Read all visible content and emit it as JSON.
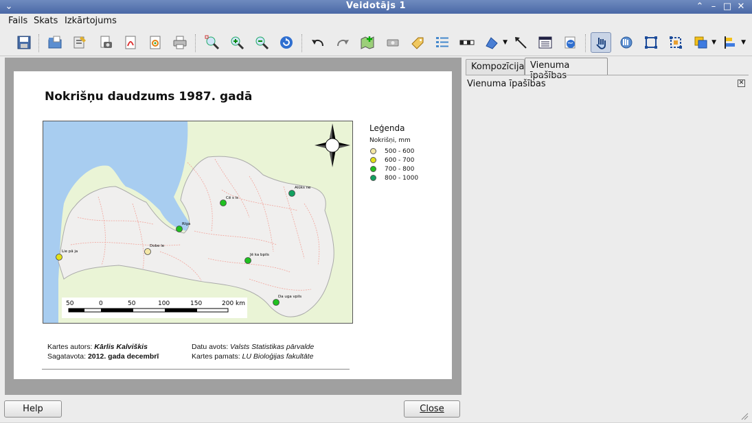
{
  "window": {
    "title": "Veidotājs 1"
  },
  "menu": {
    "items": [
      "Fails",
      "Skats",
      "Izkārtojums"
    ]
  },
  "toolbar": {
    "tools": [
      "save-icon",
      "open-template-icon",
      "save-template-icon",
      "export-image-icon",
      "export-pdf-icon",
      "export-svg-icon",
      "print-icon",
      "zoom-full-icon",
      "zoom-in-icon",
      "zoom-out-icon",
      "refresh-icon",
      "undo-icon",
      "redo-icon",
      "add-map-icon",
      "add-image-icon",
      "add-label-icon",
      "add-legend-icon",
      "add-scalebar-icon",
      "add-shape-icon",
      "add-arrow-icon",
      "add-table-icon",
      "add-html-icon",
      "select-move-icon",
      "move-content-icon",
      "group-icon",
      "ungroup-icon",
      "raise-icon",
      "align-icon"
    ]
  },
  "composition": {
    "title": "Nokrišņu daudzums 1987. gadā",
    "legend": {
      "title": "Leģenda",
      "subtitle": "Nokrišņi, mm",
      "items": [
        {
          "label": "500 - 600",
          "color": "#f4e7a6"
        },
        {
          "label": "600 - 700",
          "color": "#e3e11a"
        },
        {
          "label": "700 - 800",
          "color": "#20c020"
        },
        {
          "label": "800 - 1000",
          "color": "#12a060"
        }
      ]
    },
    "map": {
      "stations": [
        {
          "name": "Liepāja",
          "label": "Lie pā ja",
          "class": 1
        },
        {
          "name": "Dobele",
          "label": "Dobe le",
          "class": 0
        },
        {
          "name": "Rīga",
          "label": "Rīga",
          "class": 2
        },
        {
          "name": "Cēsis",
          "label": "Cē s is",
          "class": 2
        },
        {
          "name": "Alūksne",
          "label": "Alūks ne",
          "class": 3
        },
        {
          "name": "Jēkabpils",
          "label": "Jē ka bpils",
          "class": 2
        },
        {
          "name": "Daugavpils",
          "label": "Da uga vpils",
          "class": 2
        }
      ],
      "scalebar": {
        "ticks": [
          "50",
          "0",
          "50",
          "100",
          "150",
          "200 km"
        ]
      }
    },
    "credits": {
      "author_label": "Kartes autors:",
      "author": "Kārlis Kalviškis",
      "prepared_label": "Sagatavota:",
      "prepared": "2012. gada decembrī",
      "source_label": "Datu avots:",
      "source": "Valsts Statistikas pārvalde",
      "base_label": "Kartes pamats:",
      "base": "LU Bioloģijas fakultāte"
    }
  },
  "panel": {
    "tabs": [
      "Kompozīcija",
      "Vienuma īpašības"
    ],
    "dock_title": "Vienuma īpašības"
  },
  "buttons": {
    "help": "Help",
    "close": "Close"
  }
}
